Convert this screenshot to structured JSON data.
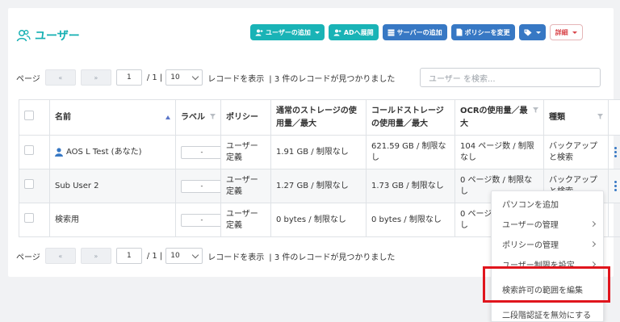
{
  "header": {
    "title": "ユーザー"
  },
  "toolbar": {
    "add_user": "ユーザーの追加",
    "ad_deploy": "ADへ展開",
    "add_server": "サーバーの追加",
    "change_policy": "ポリシーを変更",
    "details": "詳細"
  },
  "pager": {
    "label_page": "ページ",
    "prev": "«",
    "next": "»",
    "current": "1",
    "total": "/ 1 |",
    "per_page": "10",
    "records_label": "レコードを表示",
    "found_text": "| 3 件のレコードが見つかりました"
  },
  "search": {
    "placeholder": "ユーザー を検索..."
  },
  "table": {
    "columns": [
      "名前",
      "ラベル",
      "ポリシー",
      "通常のストレージの使用量／最大",
      "コールドストレージの使用量／最大",
      "OCRの使用量／最大",
      "種類"
    ],
    "rows": [
      {
        "name": "AOS L Test (あなた)",
        "label": "-",
        "policy": "ユーザー定義",
        "storage": "1.91 GB / 制限なし",
        "cold": "621.59 GB / 制限なし",
        "ocr": "104 ページ数 / 制限なし",
        "type": "バックアップと検索"
      },
      {
        "name": "Sub User 2",
        "label": "-",
        "policy": "ユーザー定義",
        "storage": "1.27 GB / 制限なし",
        "cold": "1.73 GB / 制限なし",
        "ocr": "0 ページ数 / 制限なし",
        "type": "バックアップと検索"
      },
      {
        "name": "検索用",
        "label": "-",
        "policy": "ユーザー定義",
        "storage": "0 bytes / 制限なし",
        "cold": "0 bytes / 制限なし",
        "ocr": "0 ページ数 / 制限なし",
        "type": ""
      }
    ]
  },
  "context_menu": {
    "items": [
      {
        "label": "パソコンを追加"
      },
      {
        "label": "ユーザーの管理"
      },
      {
        "label": "ポリシーの管理"
      },
      {
        "label": "ユーザー制限を設定"
      },
      {
        "label": "検索許可の範囲を編集"
      },
      {
        "label": "二段階認証を無効にする"
      }
    ]
  },
  "colors": {
    "accent": "#19b3b6",
    "primary": "#3778c4",
    "danger": "#d9454a",
    "highlight": "#e0151d"
  }
}
